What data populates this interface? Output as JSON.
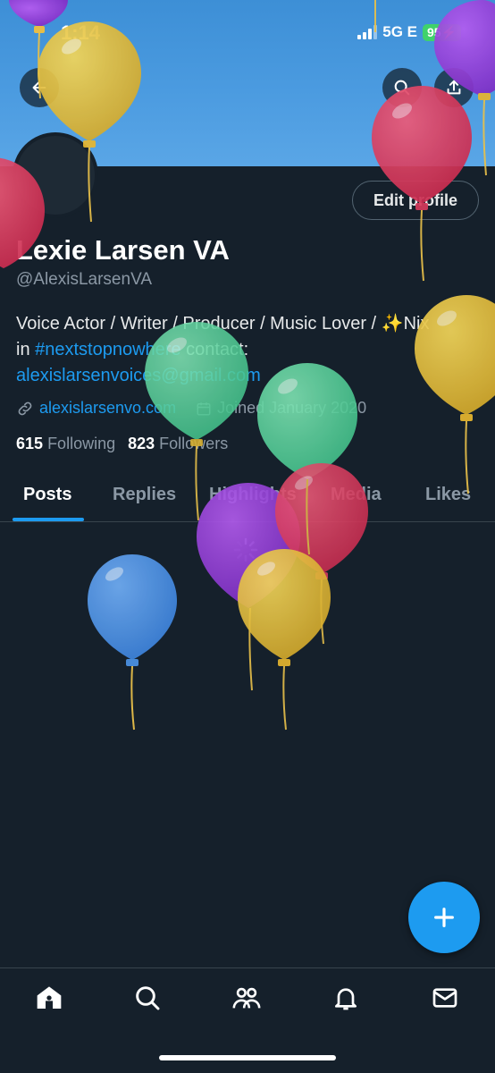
{
  "status_bar": {
    "time": "1:14",
    "network": "5G E",
    "battery": "95"
  },
  "profile": {
    "display_name": "Lexie Larsen VA",
    "handle": "@AlexisLarsenVA",
    "edit_button_label": "Edit profile",
    "bio": {
      "line1": "Voice Actor / Writer / Producer / Music Lover / ",
      "sparkle": "✨",
      "line1_end": "Nix",
      "line2_pre": "in ",
      "hashtag": "#nextstopnowhere",
      "line2_post": " contact:",
      "email": "alexislarsenvoices@gmail.com"
    },
    "website": "alexislarsenvo.com",
    "joined": "Joined January 2020",
    "following_count": "615",
    "following_label": "Following",
    "followers_count": "823",
    "followers_label": "Followers"
  },
  "tabs": [
    {
      "label": "Posts"
    },
    {
      "label": "Replies"
    },
    {
      "label": "Highlights"
    },
    {
      "label": "Media"
    },
    {
      "label": "Likes"
    }
  ],
  "colors": {
    "background": "#15202b",
    "accent": "#1d9bf0",
    "banner": "#4b9be0"
  }
}
